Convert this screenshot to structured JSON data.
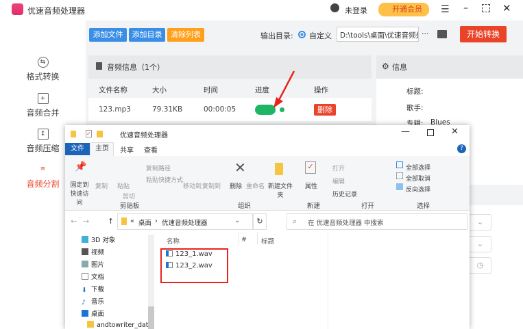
{
  "app": {
    "title": "优速音频处理器",
    "login": "未登录",
    "vip": "开通会员",
    "colors": {
      "accent": "#e9442a",
      "blue": "#3a8ee6",
      "orange": "#ff9f1a",
      "green": "#1eb564"
    }
  },
  "toolbar": {
    "add_file": "添加文件",
    "add_dir": "添加目录",
    "clear": "清除列表",
    "output_label": "输出目录:",
    "radio_label": "自定义",
    "output_path": "D:\\tools\\桌面\\优速音频处理器",
    "more": "···",
    "start": "开始转换"
  },
  "sidebar": {
    "items": [
      {
        "label": "格式转换"
      },
      {
        "label": "音频合并"
      },
      {
        "label": "音频压缩"
      },
      {
        "label": "音频分割",
        "active": true
      }
    ]
  },
  "list": {
    "title": "音频信息（1个）",
    "headers": [
      "文件名称",
      "大小",
      "时间",
      "进度",
      "操作"
    ],
    "rows": [
      {
        "name": "123.mp3",
        "size": "79.31KB",
        "time": "00:00:05",
        "progress": 100,
        "action": "删除"
      }
    ]
  },
  "info": {
    "title": "信息",
    "fields": [
      {
        "label": "标题:",
        "value": ""
      },
      {
        "label": "歌手:",
        "value": ""
      },
      {
        "label": "专辑:",
        "value": "Blues"
      }
    ]
  },
  "explorer": {
    "title": "优速音频处理器",
    "tabs": [
      "文件",
      "主页",
      "共享",
      "查看"
    ],
    "ribbon": {
      "pin": "固定到快速访问",
      "copy": "复制",
      "paste": "粘贴",
      "copy_path": "复制路径",
      "paste_shortcut": "粘贴快捷方式",
      "cut": "剪切",
      "move_to": "移动到",
      "copy_to": "复制到",
      "delete": "删除",
      "rename": "重命名",
      "new_folder": "新建文件夹",
      "properties": "属性",
      "open": "打开",
      "edit": "编辑",
      "history": "历史记录",
      "select_all": "全部选择",
      "select_none": "全部取消",
      "invert": "反向选择",
      "groups": [
        "剪贴板",
        "组织",
        "新建",
        "打开",
        "选择"
      ]
    },
    "breadcrumb": [
      "«",
      "桌面",
      "优速音频处理器"
    ],
    "search_placeholder": "在 优速音频处理器 中搜索",
    "nav": [
      "3D 对象",
      "视频",
      "图片",
      "文档",
      "下载",
      "音乐",
      "桌面",
      "andtowriter_data"
    ],
    "columns": [
      "名称",
      "#",
      "标题"
    ],
    "files": [
      "123_1.wav",
      "123_2.wav"
    ]
  }
}
